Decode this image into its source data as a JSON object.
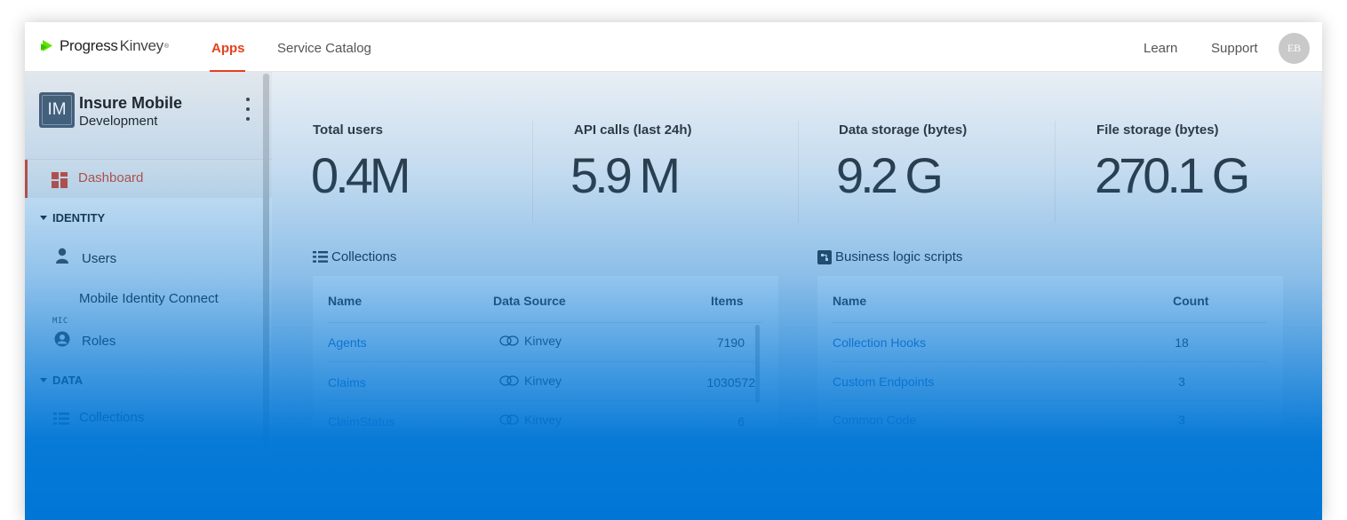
{
  "header": {
    "logo_brand": "Progress",
    "logo_product": "Kinvey",
    "logo_tm": "®",
    "nav": {
      "apps": "Apps",
      "service_catalog": "Service Catalog"
    },
    "right": {
      "learn": "Learn",
      "support": "Support",
      "avatar_initials": "EB"
    }
  },
  "sidebar": {
    "app": {
      "icon_initials": "IM",
      "name": "Insure Mobile",
      "environment": "Development"
    },
    "dashboard_label": "Dashboard",
    "sections": {
      "identity": "IDENTITY",
      "data": "DATA"
    },
    "items": {
      "users": "Users",
      "mic_abbr": "MIC",
      "mic": "Mobile Identity Connect",
      "roles": "Roles",
      "collections": "Collections"
    }
  },
  "stats": {
    "total_users": {
      "label": "Total users",
      "value": "0.4M"
    },
    "api_calls": {
      "label": "API calls (last 24h)",
      "value": "5.9 M"
    },
    "data_storage": {
      "label": "Data storage (bytes)",
      "value": "9.2 G"
    },
    "file_storage": {
      "label": "File storage (bytes)",
      "value": "270.1 G"
    }
  },
  "collections": {
    "title": "Collections",
    "columns": {
      "name": "Name",
      "source": "Data Source",
      "items": "Items"
    },
    "rows": [
      {
        "name": "Agents",
        "source": "Kinvey",
        "items": "7190"
      },
      {
        "name": "Claims",
        "source": "Kinvey",
        "items": "1030572"
      },
      {
        "name": "ClaimStatus",
        "source": "Kinvey",
        "items": "6"
      }
    ]
  },
  "business_logic": {
    "title": "Business logic scripts",
    "columns": {
      "name": "Name",
      "count": "Count"
    },
    "rows": [
      {
        "name": "Collection Hooks",
        "count": "18"
      },
      {
        "name": "Custom Endpoints",
        "count": "3"
      },
      {
        "name": "Common Code",
        "count": "3"
      }
    ]
  },
  "colors": {
    "accent": "#e2431e",
    "overlay_blue": "#0076d6",
    "link": "#2a70c9",
    "brand_green": "#5ce500"
  }
}
